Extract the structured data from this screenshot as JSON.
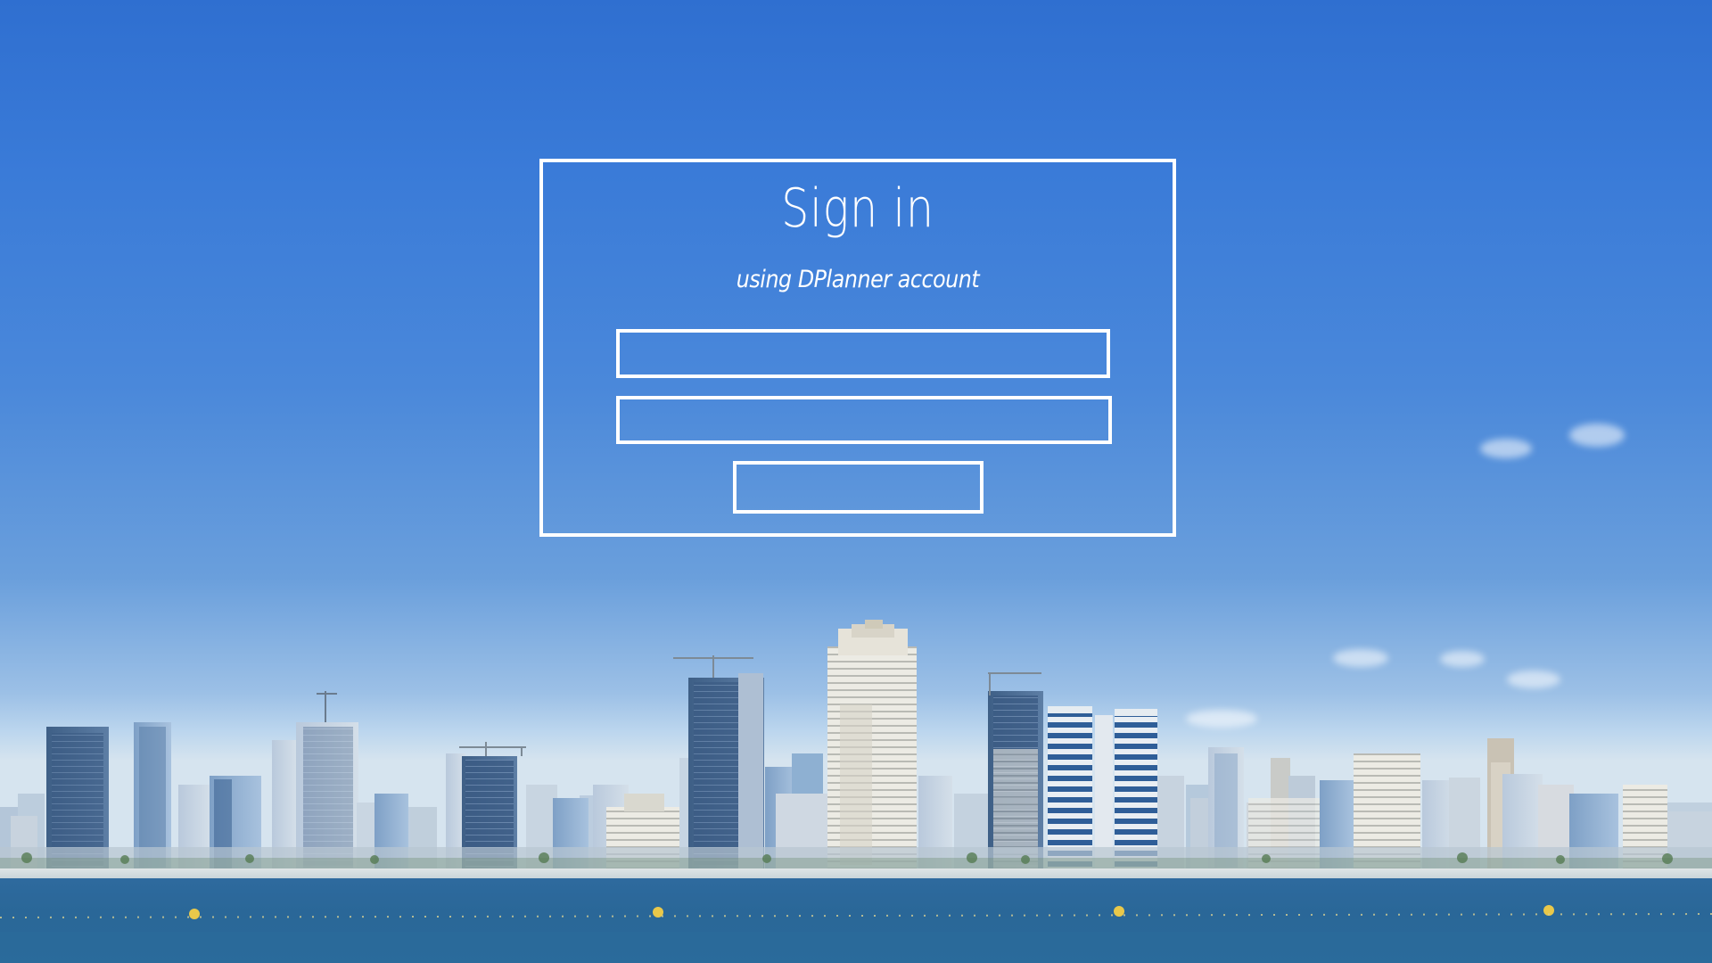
{
  "signin": {
    "title": "Sign in",
    "subtitle": "using DPlanner account",
    "username_value": "",
    "username_placeholder": "",
    "password_value": "",
    "password_placeholder": "",
    "button_label": ""
  },
  "colors": {
    "sky_top": "#2f6fd0",
    "sky_horizon": "#d6e4ef",
    "sea": "#2b6a9a",
    "form_stroke": "#ffffff"
  }
}
